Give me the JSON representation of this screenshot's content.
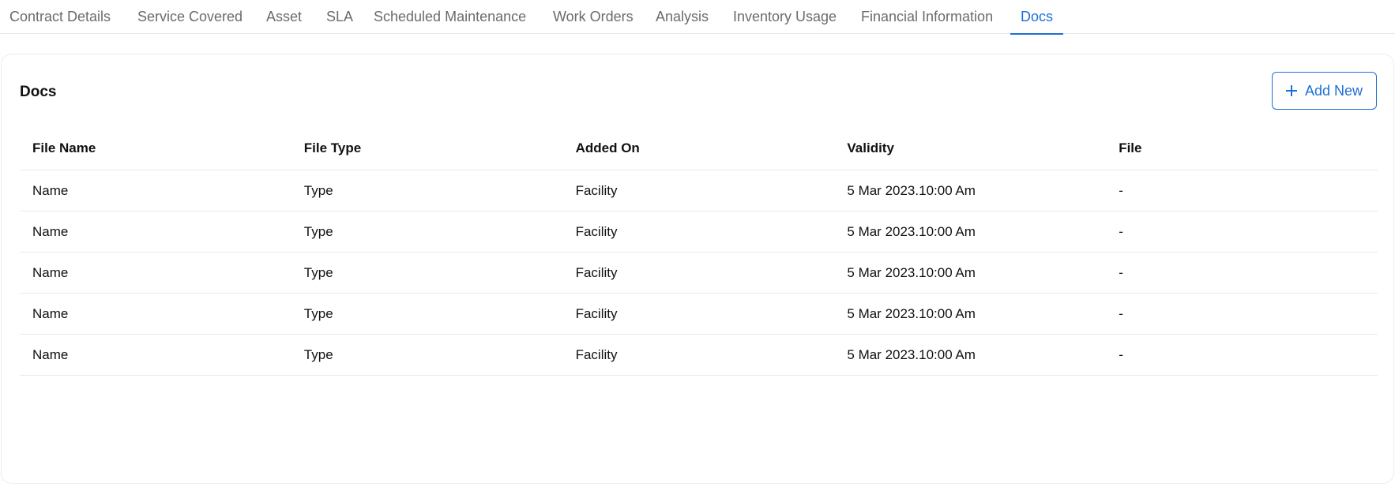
{
  "tabs": [
    {
      "label": "Contract Details"
    },
    {
      "label": "Service Covered"
    },
    {
      "label": "Asset"
    },
    {
      "label": "SLA"
    },
    {
      "label": "Scheduled Maintenance"
    },
    {
      "label": "Work Orders"
    },
    {
      "label": "Analysis"
    },
    {
      "label": "Inventory Usage"
    },
    {
      "label": "Financial Information"
    },
    {
      "label": "Docs",
      "active": true
    }
  ],
  "card": {
    "title": "Docs",
    "add_button_label": "Add New"
  },
  "table": {
    "columns": [
      "File Name",
      "File Type",
      "Added On",
      "Validity",
      "File"
    ],
    "rows": [
      [
        "Name",
        "Type",
        "Facility",
        "5 Mar 2023.10:00 Am",
        "-"
      ],
      [
        "Name",
        "Type",
        "Facility",
        "5 Mar 2023.10:00 Am",
        "-"
      ],
      [
        "Name",
        "Type",
        "Facility",
        "5 Mar 2023.10:00 Am",
        "-"
      ],
      [
        "Name",
        "Type",
        "Facility",
        "5 Mar 2023.10:00 Am",
        "-"
      ],
      [
        "Name",
        "Type",
        "Facility",
        "5 Mar 2023.10:00 Am",
        "-"
      ]
    ]
  },
  "colors": {
    "accent": "#1f6fd6",
    "tab_text": "#6b6b6b",
    "border": "#e9e9e9"
  }
}
